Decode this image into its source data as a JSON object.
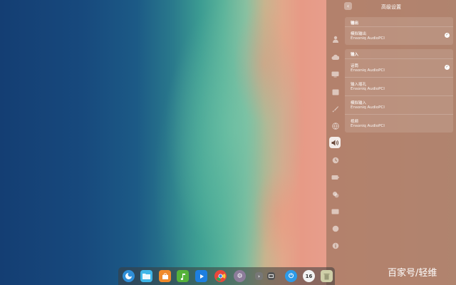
{
  "panel": {
    "title": "高级设置",
    "back_icon": "chevron-left-icon",
    "rail_icons": [
      "user-icon",
      "cloud-icon",
      "display-icon",
      "calendar-icon",
      "personalization-icon",
      "network-icon",
      "sound-icon",
      "time-icon",
      "power-icon",
      "mouse-icon",
      "keyboard-icon",
      "update-icon",
      "info-icon"
    ],
    "active_rail_icon": "sound-icon"
  },
  "output": {
    "section_label": "输出",
    "devices": [
      {
        "name": "模拟输出",
        "sub": "Ensoniq AudioPCI",
        "selected": true
      }
    ]
  },
  "input": {
    "section_label": "输入",
    "devices": [
      {
        "name": "话筒",
        "sub": "Ensoniq AudioPCI",
        "selected": true
      },
      {
        "name": "输入插孔",
        "sub": "Ensoniq AudioPCI",
        "selected": false
      },
      {
        "name": "模拟输入",
        "sub": "Ensoniq AudioPCI",
        "selected": false
      },
      {
        "name": "视频",
        "sub": "Ensoniq AudioPCI",
        "selected": false
      }
    ]
  },
  "dock": {
    "apps": [
      {
        "name": "launcher-icon",
        "color": "#2f8fd8"
      },
      {
        "name": "file-manager-icon",
        "color": "#3fb6e8"
      },
      {
        "name": "app-store-icon",
        "color": "#f08a2b"
      },
      {
        "name": "music-icon",
        "color": "#55b23a"
      },
      {
        "name": "video-icon",
        "color": "#1d7fe0"
      },
      {
        "name": "chrome-icon",
        "color": "#e8473b"
      },
      {
        "name": "settings-icon",
        "color": "#8c7c9a"
      },
      {
        "name": "expand-arrow-icon",
        "color": "#777777"
      },
      {
        "name": "multitask-icon",
        "color": "#555555"
      },
      {
        "name": "power-icon",
        "color": "#2d9be8"
      },
      {
        "name": "clock-icon",
        "color": "#f2f2f2"
      },
      {
        "name": "trash-icon",
        "color": "#cfcfa8"
      }
    ],
    "clock_label": "16",
    "power_glyph": "⏻",
    "settings_glyph": "⚙",
    "expand_glyph": "›"
  },
  "watermark": "百家号/轻维",
  "colors": {
    "panel_bg": "#a07660",
    "accent": "#ffffff"
  }
}
